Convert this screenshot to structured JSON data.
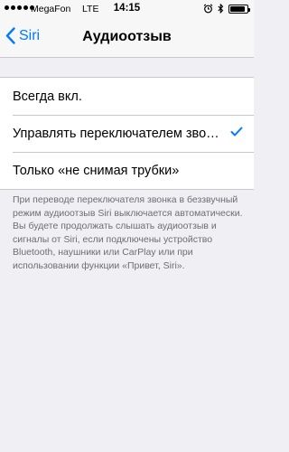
{
  "status_bar": {
    "carrier": "MegaFon",
    "network": "LTE",
    "time": "14:15",
    "battery_level": 0.9,
    "icons": [
      "signal-dots-icon",
      "alarm-icon",
      "bluetooth-icon",
      "battery-icon"
    ]
  },
  "nav": {
    "back_label": "Siri",
    "title": "Аудиоотзыв"
  },
  "options": [
    {
      "label": "Всегда вкл.",
      "selected": false
    },
    {
      "label": "Управлять переключателем звонка",
      "selected": true
    },
    {
      "label": "Только «не снимая трубки»",
      "selected": false
    }
  ],
  "footer": {
    "text": "При переводе переключателя звонка в беззвучный режим аудиоотзыв Siri выключается автоматически. Вы будете продолжать слышать аудиоотзыв и сигналы от Siri, если подключены устройство Bluetooth, наушники или CarPlay или при использовании функции «Привет, Siri»."
  },
  "colors": {
    "accent": "#007aff",
    "background": "#efeff4",
    "footer_text": "#6d6d72"
  }
}
